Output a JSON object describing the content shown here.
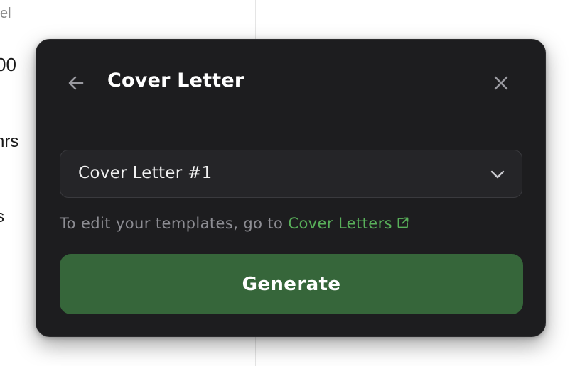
{
  "background": {
    "fragments": [
      "el",
      "00",
      "hrs",
      "s"
    ]
  },
  "modal": {
    "title": "Cover Letter",
    "back_icon": "arrow-left-icon",
    "close_icon": "close-icon",
    "template_select": {
      "selected": "Cover Letter #1",
      "chevron_icon": "chevron-down-icon"
    },
    "hint": {
      "prefix": "To edit your templates, go to ",
      "link_label": "Cover Letters",
      "link_icon": "external-link-icon"
    },
    "generate_label": "Generate"
  },
  "colors": {
    "modal_bg": "#1d1d1f",
    "accent_green": "#59b05a",
    "button_green": "#36663a",
    "muted_text": "#8d8d93"
  }
}
